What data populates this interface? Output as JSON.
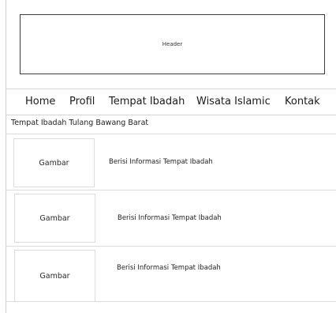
{
  "header": {
    "label": "Header"
  },
  "nav": {
    "items": [
      {
        "label": "Home"
      },
      {
        "label": "Profil"
      },
      {
        "label": "Tempat Ibadah"
      },
      {
        "label": "Wisata Islamic"
      },
      {
        "label": "Kontak"
      }
    ]
  },
  "page": {
    "subtitle": "Tempat Ibadah Tulang Bawang Barat"
  },
  "list": {
    "items": [
      {
        "image_label": "Gambar",
        "info": "Berisi Informasi Tempat Ibadah"
      },
      {
        "image_label": "Gambar",
        "info": "Berisi Informasi Tempat Ibadah"
      },
      {
        "image_label": "Gambar",
        "info": "Berisi Informasi Tempat Ibadah"
      }
    ]
  }
}
